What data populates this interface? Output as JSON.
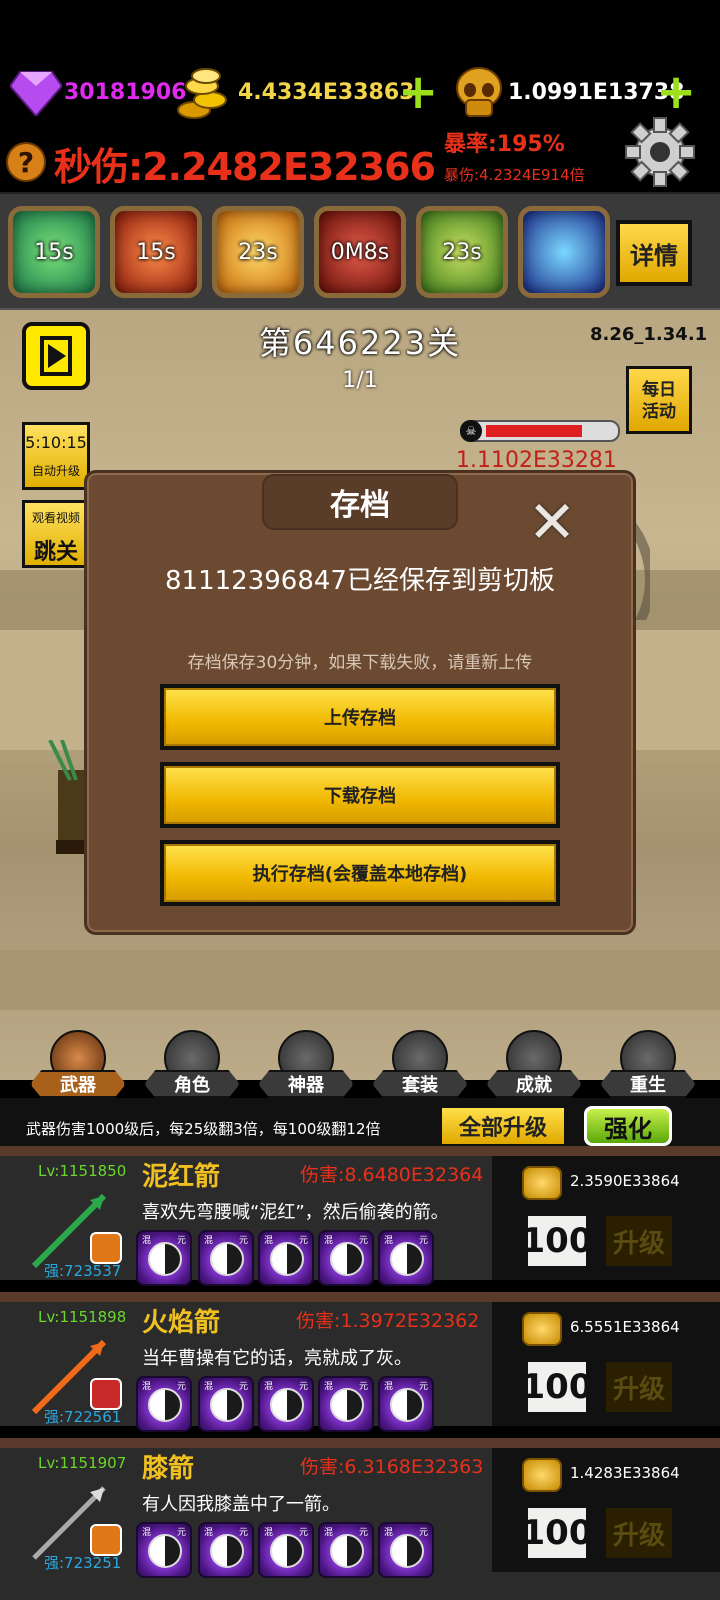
{
  "top": {
    "gems": "30181906",
    "gold": "4.4334E33863",
    "skulls": "1.0991E13738",
    "dps_label": "秒伤:2.2482E32366",
    "crit_rate": "暴率:195%",
    "crit_dmg": "暴伤:4.2324E914倍",
    "help_icon": "question-icon",
    "settings_icon": "gear-icon",
    "plus_glyph": "+"
  },
  "skills": {
    "items": [
      {
        "label": "15s",
        "color": "#3aa86a"
      },
      {
        "label": "15s",
        "color": "#c83a1a"
      },
      {
        "label": "23s",
        "color": "#d88a18"
      },
      {
        "label": "0M8s",
        "color": "#a82818"
      },
      {
        "label": "23s",
        "color": "#4a9a2a"
      },
      {
        "label": "",
        "color": "#2a4aa8"
      }
    ],
    "detail_button": "详情"
  },
  "scene": {
    "level": "第646223关",
    "wave": "1/1",
    "version": "8.26_1.34.1",
    "daily_event": "每日\n活动",
    "timer": "5:10:15",
    "auto_upgrade": "自动升级",
    "watch_video": "观看视频",
    "skip_level": "跳关",
    "boss_hp": "1.1102E33281",
    "play_icon": "play-icon"
  },
  "dialog": {
    "title": "存档",
    "message": "81112396847已经保存到剪切板",
    "note": "存档保存30分钟，如果下载失败，请重新上传",
    "upload": "上传存档",
    "download": "下载存档",
    "apply": "执行存档(会覆盖本地存档)",
    "close_glyph": "✕"
  },
  "tabs": [
    {
      "label": "武器",
      "icon": "axe-icon"
    },
    {
      "label": "角色",
      "icon": "character-icon"
    },
    {
      "label": "神器",
      "icon": "artifact-icon"
    },
    {
      "label": "套装",
      "icon": "helmet-icon"
    },
    {
      "label": "成就",
      "icon": "book-icon"
    },
    {
      "label": "重生",
      "icon": "flame-icon"
    }
  ],
  "info": {
    "text": "武器伤害1000级后，每25级翻3倍，每100级翻12倍",
    "upgrade_all": "全部升级",
    "enhance": "强化"
  },
  "weapons": [
    {
      "level": "Lv:1151850",
      "enhance": "强:723537",
      "name": "泥红箭",
      "damage": "伤害:8.6480E32364",
      "desc": "喜欢先弯腰喊“泥红”，然后偷袭的箭。",
      "cost": "2.3590E33864",
      "count": "100",
      "upgrade": "升级"
    },
    {
      "level": "Lv:1151898",
      "enhance": "强:722561",
      "name": "火焰箭",
      "damage": "伤害:1.3972E32362",
      "desc": "当年曹操有它的话，亮就成了灰。",
      "cost": "6.5551E33864",
      "count": "100",
      "upgrade": "升级"
    },
    {
      "level": "Lv:1151907",
      "enhance": "强:723251",
      "name": "膝箭",
      "damage": "伤害:6.3168E32363",
      "desc": "有人因我膝盖中了一箭。",
      "cost": "1.4283E33864",
      "count": "100",
      "upgrade": "升级"
    }
  ],
  "orb_labels": [
    "混",
    "元"
  ]
}
